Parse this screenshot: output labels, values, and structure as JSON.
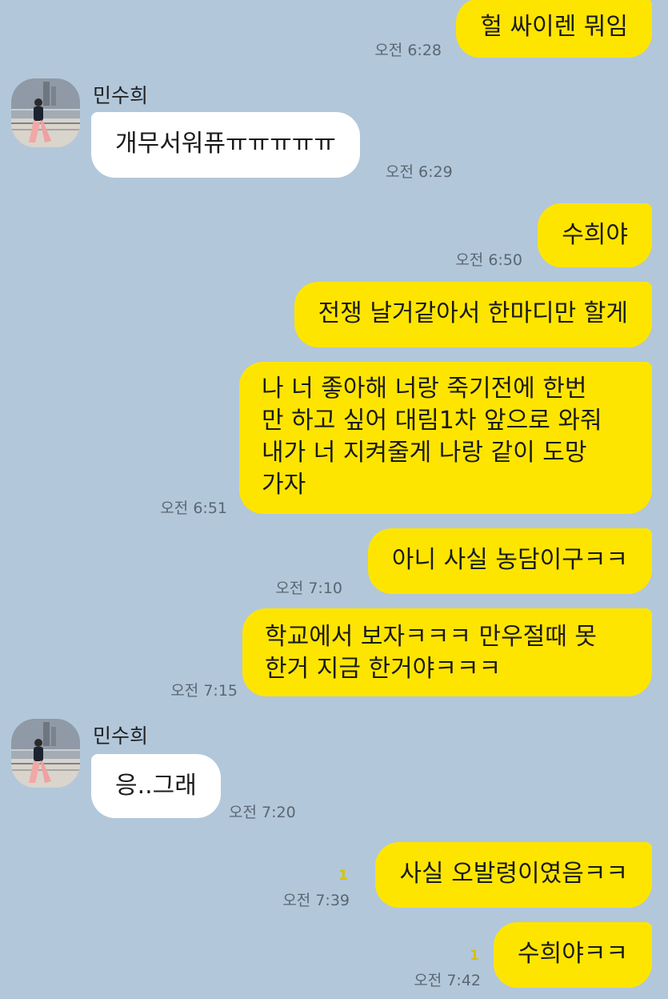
{
  "colors": {
    "background": "#b2c7da",
    "my_bubble": "#fee500",
    "their_bubble": "#ffffff",
    "time_text": "#5b6672",
    "unread_badge": "#d4c20a"
  },
  "contact": {
    "name": "민수희",
    "avatar_icon": "profile-photo-icon"
  },
  "messages": [
    {
      "sender": "me",
      "lines": [
        "헐 싸이렌 뭐임"
      ],
      "time": "오전 6:28"
    },
    {
      "sender": "them",
      "lines": [
        "개무서워퓨ㅠㅠㅠㅠㅠ"
      ],
      "time": "오전 6:29"
    },
    {
      "sender": "me",
      "lines": [
        "수희야"
      ],
      "time": ""
    },
    {
      "sender": "me",
      "lines": [
        "전쟁 날거같아서 한마디만 할게"
      ],
      "time": "오전 6:50"
    },
    {
      "sender": "me",
      "lines": [
        "나 너 좋아해 너랑 죽기전에 한번",
        "만 하고 싶어 대림1차 앞으로 와줘",
        "내가 너 지켜줄게 나랑 같이 도망",
        "가자"
      ],
      "time": "오전 6:51"
    },
    {
      "sender": "me",
      "lines": [
        "아니 사실 농담이구ㅋㅋ"
      ],
      "time": "오전 7:10"
    },
    {
      "sender": "me",
      "lines": [
        "학교에서 보자ㅋㅋㅋ 만우절때 못",
        "한거 지금 한거야ㅋㅋㅋ"
      ],
      "time": "오전 7:15"
    },
    {
      "sender": "them",
      "lines": [
        "응..그래"
      ],
      "time": "오전 7:20"
    },
    {
      "sender": "me",
      "lines": [
        "사실 오발령이였음ㅋㅋ"
      ],
      "time": "오전 7:39",
      "unread": "1"
    },
    {
      "sender": "me",
      "lines": [
        "수희야ㅋㅋ"
      ],
      "time": "오전 7:42",
      "unread": "1"
    }
  ]
}
